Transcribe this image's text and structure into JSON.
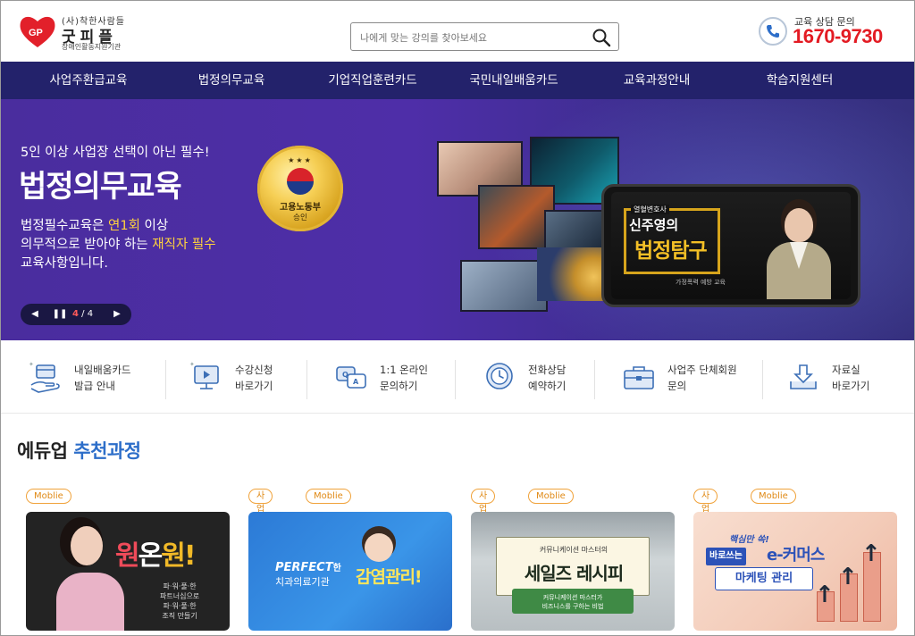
{
  "header": {
    "logo_small": "(사)착한사람들",
    "logo_main": "굿피플",
    "logo_sub": "장애인활동지원기관",
    "search_placeholder": "나에게 맞는 강의를 찾아보세요",
    "contact_label": "교육 상담 문의",
    "contact_number": "1670-9730"
  },
  "nav": {
    "items": [
      {
        "label": "사업주환급교육"
      },
      {
        "label": "법정의무교육"
      },
      {
        "label": "기업직업훈련카드"
      },
      {
        "label": "국민내일배움카드"
      },
      {
        "label": "교육과정안내"
      },
      {
        "label": "학습지원센터"
      }
    ]
  },
  "hero": {
    "sub": "5인 이상 사업장 선택이 아닌 필수!",
    "title": "법정의무교육",
    "desc_1a": "법정필수교육은 ",
    "desc_1b": "연1회",
    "desc_1c": " 이상",
    "desc_2a": "의무적으로 받아야 하는 ",
    "desc_2b": "재직자 필수",
    "desc_3": "교육사항입니다.",
    "seal_line1": "고용노동부",
    "seal_line2": "승인",
    "phone_tag": "열혈변호사",
    "phone_name": "신주영의",
    "phone_title": "법정탐구",
    "phone_caption": "가정폭력 예방 교육",
    "pager_current": "4",
    "pager_total": " / 4"
  },
  "quick_links": [
    {
      "label": "내일배움카드\n발급 안내",
      "icon": "card-hand-icon"
    },
    {
      "label": "수강신청\n바로가기",
      "icon": "monitor-play-icon"
    },
    {
      "label": "1:1 온라인\n문의하기",
      "icon": "chat-qa-icon"
    },
    {
      "label": "전화상담\n예약하기",
      "icon": "clock-phone-icon"
    },
    {
      "label": "사업주 단체회원\n문의",
      "icon": "briefcase-icon"
    },
    {
      "label": "자료실\n바로가기",
      "icon": "download-icon"
    }
  ],
  "recommended": {
    "title_a": "에듀업 ",
    "title_b": "추천과정",
    "cards": [
      {
        "tags": [
          "Moblie"
        ],
        "title_parts": [
          "원",
          "온",
          "원!"
        ],
        "sub": "파·워·풀·한\n파트너십으로\n파·워·풀·한\n조직 만들기"
      },
      {
        "tags": [
          "사업주",
          "Moblie"
        ],
        "title": "PERFECT",
        "title_suffix": "한",
        "line2": "치과의료기관",
        "big": "감염관리!"
      },
      {
        "tags": [
          "사업주",
          "Moblie"
        ],
        "small": "커뮤니케이션 마스터의",
        "big": "세일즈 레시피",
        "band1": "커뮤니케이션 마스터가",
        "band2": "비즈니스를 구하는 비법"
      },
      {
        "tags": [
          "사업주",
          "Moblie"
        ],
        "top": "핵심만 쏙!",
        "chip": "바로쓰는",
        "big": "e-커머스",
        "sub": "마케팅 관리"
      }
    ]
  },
  "colors": {
    "nav_bg": "#23226b",
    "accent_red": "#e31b23",
    "hero_bg": "#4e2ea8",
    "highlight_yellow": "#ffd23d",
    "tag_orange": "#e08a16",
    "title_blue": "#2d6ec9"
  }
}
